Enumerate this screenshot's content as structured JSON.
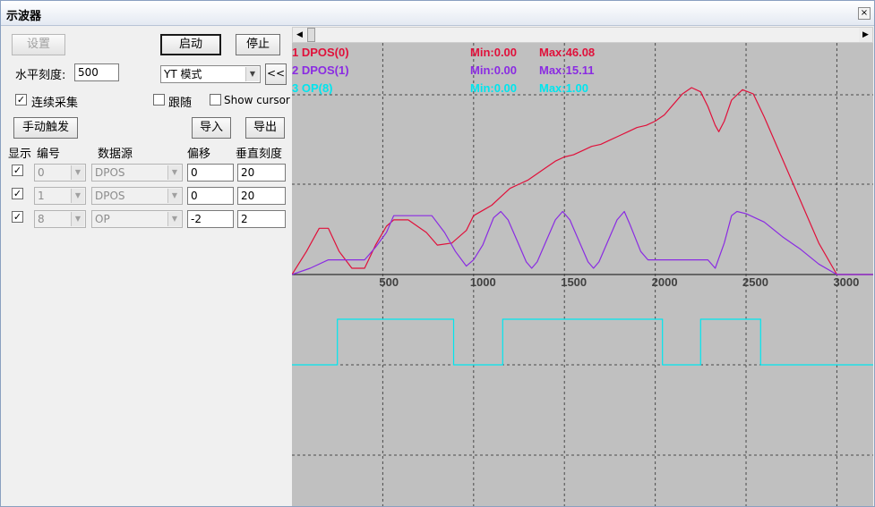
{
  "window": {
    "title": "示波器",
    "close_glyph": "×"
  },
  "controls": {
    "settings_label": "设置",
    "start_label": "启动",
    "stop_label": "停止",
    "hscale_label": "水平刻度:",
    "hscale_value": "500",
    "mode_value": "YT 模式",
    "collapse_label": "<<",
    "continuous_label": "连续采集",
    "continuous_checked": true,
    "follow_label": "跟随",
    "follow_checked": false,
    "show_cursor_label": "Show cursor",
    "show_cursor_checked": false,
    "manual_trigger_label": "手动触发",
    "import_label": "导入",
    "export_label": "导出"
  },
  "channel_table": {
    "headers": [
      "显示",
      "编号",
      "数据源",
      "偏移",
      "垂直刻度"
    ],
    "rows": [
      {
        "show": true,
        "number": "0",
        "source": "DPOS",
        "offset": "0",
        "vscale": "20"
      },
      {
        "show": true,
        "number": "1",
        "source": "DPOS",
        "offset": "0",
        "vscale": "20"
      },
      {
        "show": true,
        "number": "8",
        "source": "OP",
        "offset": "-2",
        "vscale": "2"
      }
    ]
  },
  "legend": [
    {
      "label": "1 DPOS(0)",
      "min": "Min:0.00",
      "max": "Max:46.08",
      "color": "#e0103a"
    },
    {
      "label": "2 DPOS(1)",
      "min": "Min:0.00",
      "max": "Max:15.11",
      "color": "#8a2be2"
    },
    {
      "label": "3 OP(8)",
      "min": "Min:0.00",
      "max": "Max:1.00",
      "color": "#00e5ee"
    }
  ],
  "chart_data": {
    "type": "line",
    "xlim": [
      0,
      3200
    ],
    "x_ticks": [
      500,
      1000,
      1500,
      2000,
      2500,
      3000
    ],
    "grid": true,
    "background": "#c0c0c0",
    "series": [
      {
        "name": "1 DPOS(0)",
        "color": "#e0103a",
        "points": [
          [
            0,
            0
          ],
          [
            80,
            11
          ],
          [
            150,
            22
          ],
          [
            200,
            22
          ],
          [
            260,
            11
          ],
          [
            330,
            3
          ],
          [
            400,
            3
          ],
          [
            460,
            14
          ],
          [
            520,
            23
          ],
          [
            560,
            26
          ],
          [
            640,
            26
          ],
          [
            740,
            20
          ],
          [
            800,
            14
          ],
          [
            880,
            15
          ],
          [
            960,
            21
          ],
          [
            1000,
            28
          ],
          [
            1060,
            31
          ],
          [
            1100,
            33
          ],
          [
            1150,
            37
          ],
          [
            1200,
            41
          ],
          [
            1250,
            43
          ],
          [
            1300,
            45
          ],
          [
            1350,
            48
          ],
          [
            1400,
            51
          ],
          [
            1450,
            54
          ],
          [
            1500,
            56
          ],
          [
            1550,
            57
          ],
          [
            1600,
            59
          ],
          [
            1650,
            61
          ],
          [
            1700,
            62
          ],
          [
            1750,
            64
          ],
          [
            1800,
            66
          ],
          [
            1850,
            68
          ],
          [
            1900,
            70
          ],
          [
            1950,
            71
          ],
          [
            2000,
            73
          ],
          [
            2050,
            76
          ],
          [
            2100,
            81
          ],
          [
            2150,
            86
          ],
          [
            2200,
            89
          ],
          [
            2250,
            87
          ],
          [
            2290,
            80
          ],
          [
            2330,
            71
          ],
          [
            2350,
            68
          ],
          [
            2380,
            73
          ],
          [
            2420,
            83
          ],
          [
            2480,
            88
          ],
          [
            2540,
            86
          ],
          [
            2600,
            75
          ],
          [
            2700,
            55
          ],
          [
            2800,
            35
          ],
          [
            2900,
            15
          ],
          [
            3000,
            0
          ],
          [
            3200,
            0
          ]
        ]
      },
      {
        "name": "2 DPOS(1)",
        "color": "#8a2be2",
        "points": [
          [
            0,
            0
          ],
          [
            100,
            3
          ],
          [
            200,
            7
          ],
          [
            300,
            7
          ],
          [
            400,
            7
          ],
          [
            460,
            13
          ],
          [
            520,
            20
          ],
          [
            560,
            28
          ],
          [
            640,
            28
          ],
          [
            770,
            28
          ],
          [
            840,
            20
          ],
          [
            900,
            11
          ],
          [
            960,
            4
          ],
          [
            1000,
            7
          ],
          [
            1050,
            14
          ],
          [
            1110,
            27
          ],
          [
            1150,
            30
          ],
          [
            1190,
            26
          ],
          [
            1240,
            16
          ],
          [
            1290,
            6
          ],
          [
            1320,
            3
          ],
          [
            1350,
            6
          ],
          [
            1400,
            16
          ],
          [
            1450,
            26
          ],
          [
            1490,
            30
          ],
          [
            1530,
            26
          ],
          [
            1580,
            16
          ],
          [
            1630,
            6
          ],
          [
            1660,
            3
          ],
          [
            1690,
            6
          ],
          [
            1740,
            16
          ],
          [
            1790,
            26
          ],
          [
            1830,
            30
          ],
          [
            1860,
            24
          ],
          [
            1920,
            11
          ],
          [
            1960,
            7
          ],
          [
            2000,
            7
          ],
          [
            2100,
            7
          ],
          [
            2200,
            7
          ],
          [
            2290,
            7
          ],
          [
            2330,
            3
          ],
          [
            2380,
            15
          ],
          [
            2420,
            28
          ],
          [
            2450,
            30
          ],
          [
            2500,
            29
          ],
          [
            2600,
            25
          ],
          [
            2700,
            18
          ],
          [
            2800,
            12
          ],
          [
            2900,
            5
          ],
          [
            3000,
            0
          ],
          [
            3200,
            0
          ]
        ]
      },
      {
        "name": "3 OP(8)",
        "color": "#00e5ee",
        "points": [
          [
            0,
            0
          ],
          [
            250,
            0
          ],
          [
            250,
            1
          ],
          [
            890,
            1
          ],
          [
            890,
            0
          ],
          [
            1160,
            0
          ],
          [
            1160,
            1
          ],
          [
            2040,
            1
          ],
          [
            2040,
            0
          ],
          [
            2250,
            0
          ],
          [
            2250,
            1
          ],
          [
            2580,
            1
          ],
          [
            2580,
            0
          ],
          [
            3200,
            0
          ]
        ]
      }
    ]
  }
}
